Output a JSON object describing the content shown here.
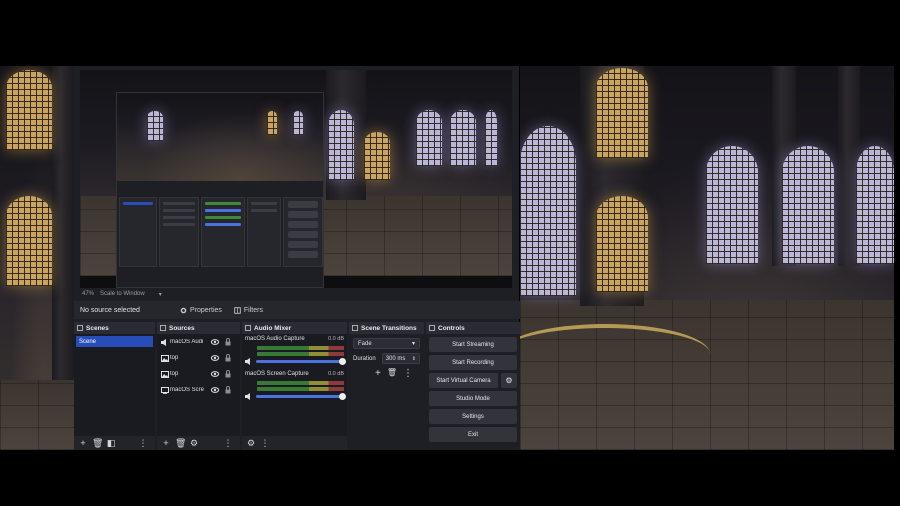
{
  "preview": {
    "zoom": "47%",
    "scale_mode": "Scale to Window"
  },
  "source_toolbar": {
    "no_source": "No source selected",
    "properties": "Properties",
    "filters": "Filters"
  },
  "docks": {
    "scenes": {
      "title": "Scenes",
      "items": [
        "Scene"
      ]
    },
    "sources": {
      "title": "Sources",
      "items": [
        {
          "name": "macOS Audi",
          "icon": "speaker-icon"
        },
        {
          "name": "top",
          "icon": "image-icon"
        },
        {
          "name": "top",
          "icon": "image-icon"
        },
        {
          "name": "macOS Scre",
          "icon": "monitor-icon"
        }
      ]
    },
    "mixer": {
      "title": "Audio Mixer",
      "channels": [
        {
          "name": "macOS Audio Capture",
          "db": "0.0 dB",
          "volume": 1.0
        },
        {
          "name": "macOS Screen Capture",
          "db": "0.0 dB",
          "volume": 1.0
        }
      ]
    },
    "transitions": {
      "title": "Scene Transitions",
      "selected": "Fade",
      "duration_label": "Duration",
      "duration_value": "300 ms"
    },
    "controls": {
      "title": "Controls",
      "start_streaming": "Start Streaming",
      "start_recording": "Start Recording",
      "start_virtual_camera": "Start Virtual Camera",
      "studio_mode": "Studio Mode",
      "settings": "Settings",
      "exit": "Exit"
    }
  },
  "colors": {
    "accent": "#284cb8",
    "panel": "#1e1f24",
    "button": "#33343b"
  }
}
